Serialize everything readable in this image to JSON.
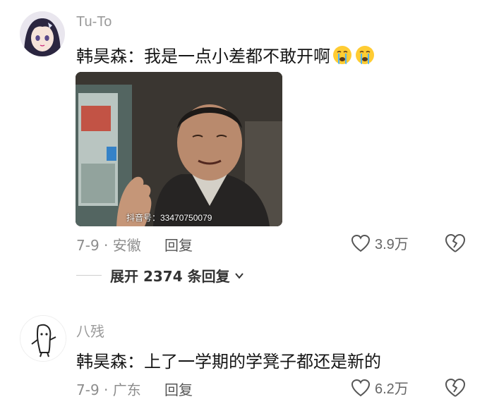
{
  "comments": [
    {
      "username": "Tu-To",
      "text": "韩昊森：我是一点小差都不敢开啊",
      "emojis": [
        "crying-face-icon",
        "crying-face-icon"
      ],
      "media": {
        "watermark": "抖音号：33470750079"
      },
      "date": "7-9",
      "location": "安徽",
      "reply_label": "回复",
      "likes": "3.9万"
    },
    {
      "username": "八残",
      "text": "韩昊森：上了一学期的学凳子都还是新的",
      "date": "7-9",
      "location": "广东",
      "reply_label": "回复",
      "likes": "6.2万"
    }
  ],
  "expand_replies": {
    "label": "展开 2374 条回复"
  },
  "colors": {
    "meta": "#8d8d8d",
    "username": "#9a9a9a",
    "text": "#161616"
  }
}
